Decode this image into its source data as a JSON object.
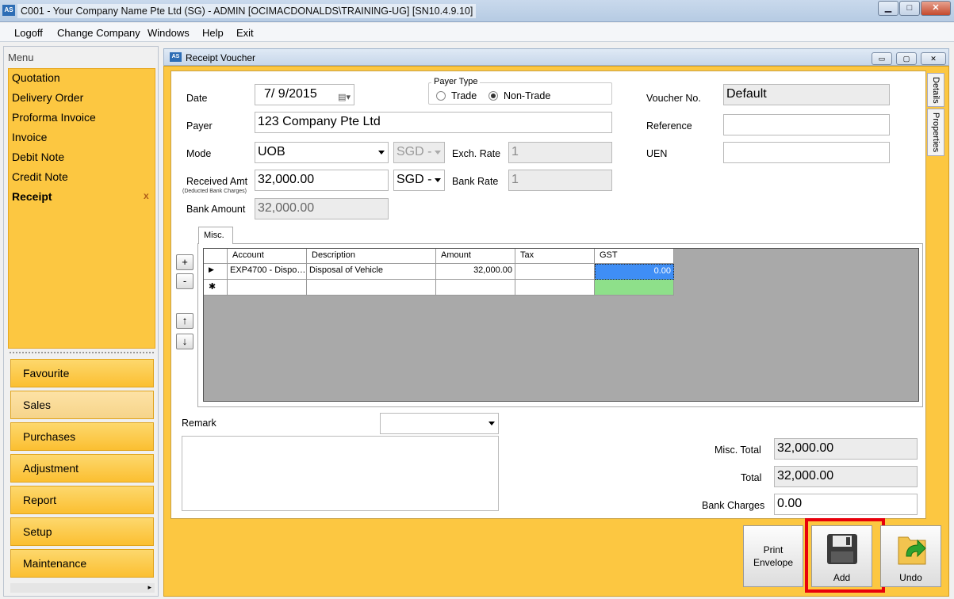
{
  "window": {
    "title": "C001 - Your Company Name Pte Ltd (SG) - ADMIN [OCIMACDONALDS\\TRAINING-UG] [SN10.4.9.10]",
    "icon_text": "AS",
    "buttons": {
      "minimize": "▁",
      "maximize": "□",
      "close": "✕"
    }
  },
  "menubar": [
    "Logoff",
    "Change Company",
    "Windows",
    "Help",
    "Exit"
  ],
  "leftnav": {
    "header": "Menu",
    "items": [
      "Quotation",
      "Delivery Order",
      "Proforma Invoice",
      "Invoice",
      "Debit Note",
      "Credit Note",
      "Receipt"
    ],
    "active_item": "Receipt",
    "close_x": "x",
    "sections": [
      "Favourite",
      "Sales",
      "Purchases",
      "Adjustment",
      "Report",
      "Setup",
      "Maintenance"
    ],
    "active_section": "Sales"
  },
  "inner_window": {
    "title": "Receipt Voucher",
    "icon_text": "AS",
    "buttons": {
      "minimize": "▭",
      "maximize": "▢",
      "close": "✕"
    }
  },
  "side_tabs": [
    "Details",
    "Properties"
  ],
  "form": {
    "date_label": "Date",
    "date_value": "7/  9/2015",
    "payer_type": {
      "label": "Payer Type",
      "options": [
        "Trade",
        "Non-Trade"
      ],
      "selected": "Non-Trade"
    },
    "voucher_no_label": "Voucher No.",
    "voucher_no_value": "Default",
    "payer_label": "Payer",
    "payer_value": "123 Company Pte Ltd",
    "reference_label": "Reference",
    "reference_value": "",
    "mode_label": "Mode",
    "mode_value": "UOB",
    "mode_currency": "SGD -",
    "exch_rate_label": "Exch. Rate",
    "exch_rate_value": "1",
    "uen_label": "UEN",
    "uen_value": "",
    "received_amt_label": "Received Amt",
    "received_amt_sublabel": "(Deducted Bank Charges)",
    "received_amt_value": "32,000.00",
    "received_currency": "SGD -",
    "bank_rate_label": "Bank Rate",
    "bank_rate_value": "1",
    "bank_amount_label": "Bank Amount",
    "bank_amount_value": "32,000.00"
  },
  "grid": {
    "tab": "Misc.",
    "side_buttons": [
      "+",
      "-",
      "↑",
      "↓"
    ],
    "columns": [
      "Account",
      "Description",
      "Amount",
      "Tax",
      "GST"
    ],
    "rows": [
      {
        "indicator": "▶",
        "account": "EXP4700 - Dispo…",
        "description": "Disposal of Vehicle",
        "amount": "32,000.00",
        "tax": "",
        "gst": "0.00"
      }
    ],
    "new_row_indicator": "✱"
  },
  "remark": {
    "label": "Remark",
    "value": ""
  },
  "totals": {
    "misc_total_label": "Misc. Total",
    "misc_total_value": "32,000.00",
    "total_label": "Total",
    "total_value": "32,000.00",
    "bank_charges_label": "Bank Charges",
    "bank_charges_value": "0.00"
  },
  "actions": {
    "print_envelope": "Print\nEnvelope",
    "add": "Add",
    "undo": "Undo"
  },
  "colors": {
    "nav_yellow": "#fcc741",
    "highlight_red": "#e8000b",
    "selected_cell": "#3f8ef5",
    "new_cell": "#8ee08a"
  }
}
